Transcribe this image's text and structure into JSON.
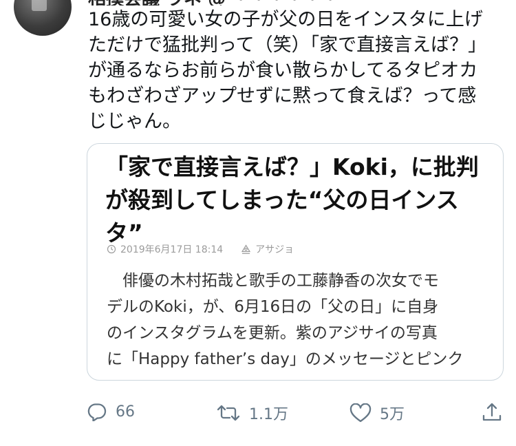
{
  "tweet": {
    "header_partial": "相撲会議 ラネ @ ・・・・・・",
    "text": "16歳の可愛い女の子が父の日をインスタに上げ\nただけで猛批判って（笑）「家で直接言えば？」\nが通るならお前らが食い散らかしてるタピオカ\nもわざわざアップせずに黙って食えば？って感\nじじゃん。"
  },
  "card": {
    "title": "「家で直接言えば？」Koki，に批判\nが殺到してしまった“父の日インス\nタ”",
    "date": "2019年6月17日 18:14",
    "source": "アサジョ",
    "body": "　俳優の木村拓哉と歌手の工藤静香の次女でモ\nデルのKoki，が、6月16日の「父の日」に自身\nのインスタグラムを更新。紫のアジサイの写真\nに「Happy father’s day」のメッセージとピンク"
  },
  "actions": {
    "reply_count": "66",
    "retweet_count": "1.1万",
    "like_count": "5万"
  },
  "icons": {
    "reply": "reply-icon",
    "retweet": "retweet-icon",
    "like": "heart-icon",
    "share": "share-icon",
    "clock": "clock-icon",
    "source": "source-icon"
  },
  "colors": {
    "icon_gray": "#657786",
    "border": "#ccd6dd",
    "meta_gray": "#9b9b9b"
  }
}
